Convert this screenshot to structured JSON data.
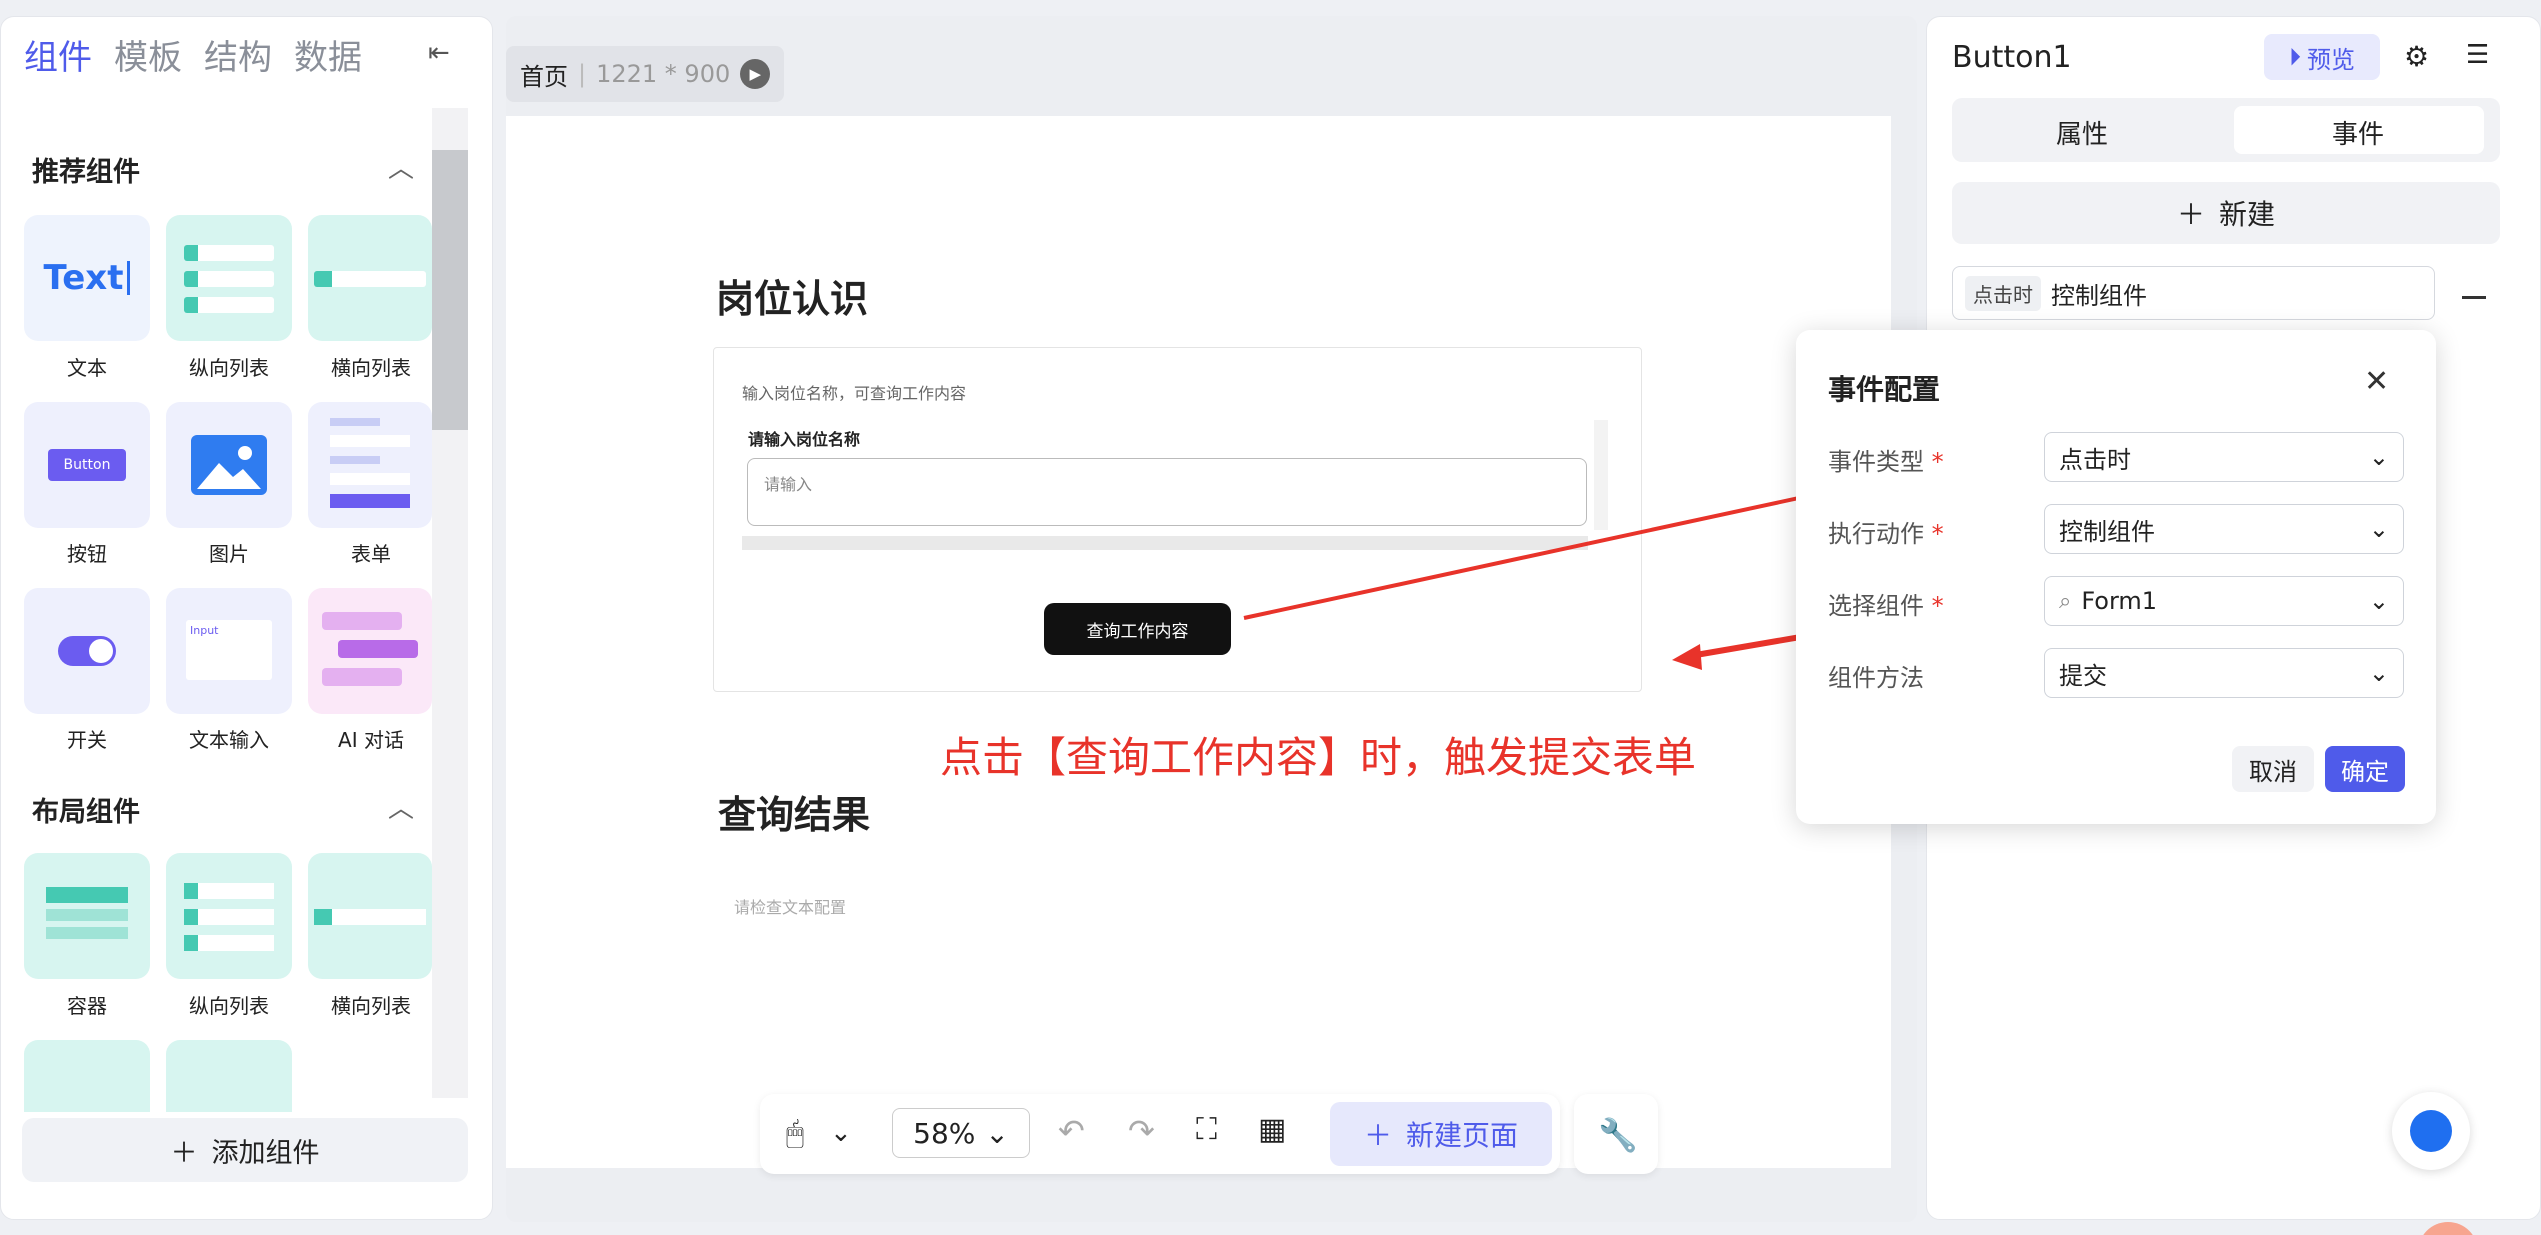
{
  "left_panel": {
    "tabs": [
      "组件",
      "模板",
      "结构",
      "数据"
    ],
    "section_recommended": "推荐组件",
    "section_layout": "布局组件",
    "recommended": [
      "文本",
      "纵向列表",
      "横向列表",
      "按钮",
      "图片",
      "表单",
      "开关",
      "文本输入",
      "AI 对话"
    ],
    "layout": [
      "容器",
      "纵向列表",
      "横向列表"
    ],
    "tile_text": "Text",
    "tile_button": "Button",
    "tile_input": "Input",
    "add_component": "添加组件"
  },
  "canvas": {
    "breadcrumb": "首页",
    "size": "1221 * 900",
    "heading1": "岗位认识",
    "form_hint": "输入岗位名称，可查询工作内容",
    "field_label": "请输入岗位名称",
    "field_placeholder": "请输入",
    "query_button": "查询工作内容",
    "heading2": "查询结果",
    "result_placeholder": "请检查文本配置",
    "annotation": "点击【查询工作内容】时，触发提交表单"
  },
  "toolbar": {
    "zoom": "58%",
    "new_page": "新建页面"
  },
  "right_panel": {
    "title": "Button1",
    "preview": "预览",
    "tab_props": "属性",
    "tab_events": "事件",
    "new": "新建",
    "event_tag": "点击时",
    "event_action": "控制组件"
  },
  "modal": {
    "title": "事件配置",
    "rows": [
      {
        "label": "事件类型",
        "required": "*",
        "value": "点击时"
      },
      {
        "label": "执行动作",
        "required": "*",
        "value": "控制组件"
      },
      {
        "label": "选择组件",
        "required": "*",
        "value": "Form1"
      },
      {
        "label": "组件方法",
        "required": "",
        "value": "提交"
      }
    ],
    "cancel": "取消",
    "ok": "确定"
  },
  "colors": {
    "accent": "#4f5bea",
    "annotation": "#e8332a",
    "teal": "#d7f5f0"
  }
}
